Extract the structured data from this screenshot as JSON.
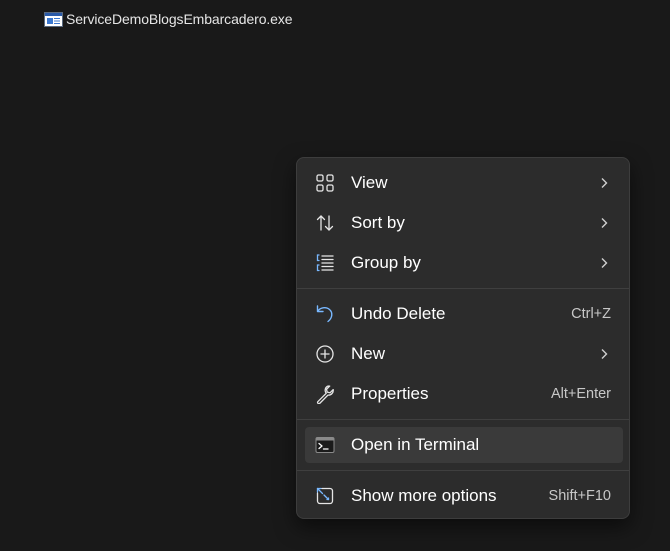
{
  "desktop": {
    "file": {
      "name": "ServiceDemoBlogsEmbarcadero.exe",
      "icon": "exe-window-icon"
    }
  },
  "context_menu": {
    "items": [
      {
        "label": "View",
        "icon": "view-grid-icon",
        "has_submenu": true
      },
      {
        "label": "Sort by",
        "icon": "sort-icon",
        "has_submenu": true
      },
      {
        "label": "Group by",
        "icon": "group-by-icon",
        "has_submenu": true
      },
      {
        "label": "Undo Delete",
        "icon": "undo-icon",
        "shortcut": "Ctrl+Z"
      },
      {
        "label": "New",
        "icon": "new-plus-icon",
        "has_submenu": true
      },
      {
        "label": "Properties",
        "icon": "wrench-icon",
        "shortcut": "Alt+Enter"
      },
      {
        "label": "Open in Terminal",
        "icon": "terminal-icon",
        "highlighted": true
      },
      {
        "label": "Show more options",
        "icon": "show-more-icon",
        "shortcut": "Shift+F10"
      }
    ],
    "colors": {
      "background": "#2c2c2c",
      "highlight": "#3a3a3a",
      "accent_icon": "#79b8ff",
      "separator": "#3f3f3f"
    }
  }
}
